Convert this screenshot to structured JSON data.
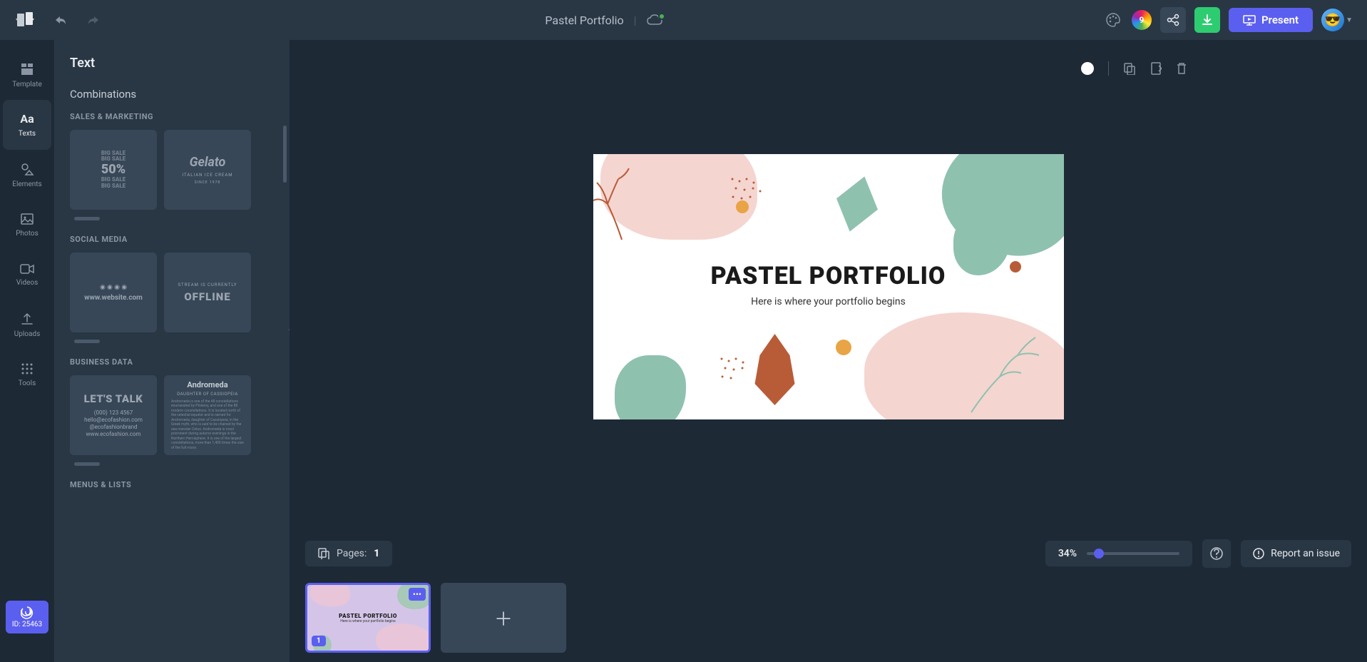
{
  "topbar": {
    "title": "Pastel Portfolio",
    "credits": "9",
    "present_label": "Present"
  },
  "leftnav": {
    "items": [
      {
        "label": "Template"
      },
      {
        "label": "Texts"
      },
      {
        "label": "Elements"
      },
      {
        "label": "Photos"
      },
      {
        "label": "Videos"
      },
      {
        "label": "Uploads"
      },
      {
        "label": "Tools"
      }
    ],
    "id_badge": "ID: 25463"
  },
  "panel": {
    "title": "Text",
    "section_title": "Combinations",
    "groups": {
      "sales": {
        "heading": "SALES & MARKETING",
        "card1": {
          "l1": "BIG SALE",
          "l2": "BIG SALE",
          "pct": "50%",
          "l3": "BIG SALE",
          "l4": "BIG SALE"
        },
        "card2": {
          "brand": "Gelato",
          "sub": "ITALIAN ICE CREAM",
          "since": "SINCE 1978"
        }
      },
      "social": {
        "heading": "SOCIAL MEDIA",
        "card1": {
          "icons": "◉ ◉ ◉ ◉",
          "url": "www.website.com"
        },
        "card2": {
          "stream": "STREAM IS CURRENTLY",
          "off": "OFFLINE"
        }
      },
      "business": {
        "heading": "BUSINESS DATA",
        "card1": {
          "headline": "LET'S TALK",
          "phone": "(000) 123 4567",
          "email": "hello@ecofashion.com",
          "handle": "@ecofashionbrand",
          "site": "www.ecofashion.com"
        },
        "card2": {
          "name": "Andromeda",
          "sub": "DAUGHTER OF CASSIOPEIA",
          "body": "Andromeda is one of the 48 constellations enumerated by Ptolemy, and one of the 88 modern constellations. It is located north of the celestial equator and is named for Andromeda, daughter of Cassiopeia, in the Greek myth, who is said to be chained by the sea monster Cetus. Andromeda is most prominent during autumn evenings in the Northern Hemisphere. It is one of the largest constellations, more than 1,400 times the size of the full moon."
        }
      },
      "menus": {
        "heading": "MENUS & LISTS"
      }
    }
  },
  "slide": {
    "title": "PASTEL PORTFOLIO",
    "subtitle": "Here is where your portfolio begins"
  },
  "footer": {
    "pages_label": "Pages:",
    "pages_count": "1",
    "zoom": "34%",
    "report_label": "Report an issue"
  },
  "strip": {
    "slide1_number": "1",
    "slide1_title": "PASTEL PORTFOLIO",
    "slide1_sub": "Here is where your portfolio begins"
  }
}
